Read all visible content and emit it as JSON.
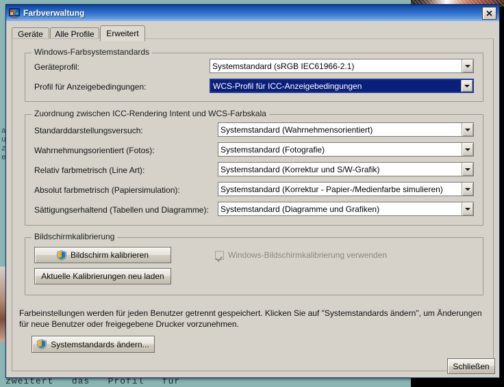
{
  "window": {
    "title": "Farbverwaltung",
    "icon": "color-monitor-icon",
    "close_label": "✕"
  },
  "tabs": [
    {
      "label": "Geräte",
      "active": false
    },
    {
      "label": "Alle Profile",
      "active": false
    },
    {
      "label": "Erweitert",
      "active": true
    }
  ],
  "groups": {
    "system_defaults": {
      "legend": "Windows-Farbsystemstandards",
      "rows": [
        {
          "label": "Geräteprofil:",
          "value": "Systemstandard (sRGB IEC61966-2.1)",
          "focused": false
        },
        {
          "label": "Profil für Anzeigebedingungen:",
          "value": "WCS-Profil für ICC-Anzeigebedingungen",
          "focused": true
        }
      ]
    },
    "rendering_intent": {
      "legend": "Zuordnung zwischen ICC-Rendering Intent und WCS-Farbskala",
      "rows": [
        {
          "label": "Standarddarstellungsversuch:",
          "value": "Systemstandard (Wahrnehmensorientiert)",
          "focused": false
        },
        {
          "label": "Wahrnehmungsorientiert (Fotos):",
          "value": "Systemstandard (Fotografie)",
          "focused": false
        },
        {
          "label": "Relativ farbmetrisch (Line Art):",
          "value": "Systemstandard (Korrektur und S/W-Grafik)",
          "focused": false
        },
        {
          "label": "Absolut farbmetrisch (Papiersimulation):",
          "value": "Systemstandard (Korrektur - Papier-/Medienfarbe simulieren)",
          "focused": false
        },
        {
          "label": "Sättigungserhaltend (Tabellen und Diagramme):",
          "value": "Systemstandard (Diagramme und Grafiken)",
          "focused": false
        }
      ]
    },
    "calibration": {
      "legend": "Bildschirmkalibrierung",
      "calibrate_button": "Bildschirm kalibrieren",
      "reload_button": "Aktuelle Kalibrierungen neu laden",
      "checkbox_label": "Windows-Bildschirmkalibrierung verwenden",
      "checkbox_checked": true,
      "checkbox_disabled": true
    }
  },
  "footer": {
    "info_line1": "Farbeinstellungen werden für jeden Benutzer getrennt gespeichert. Klicken Sie auf \"Systemstandards ändern\", um Änderungen",
    "info_line2": "für neue Benutzer oder freigegebene Drucker vorzunehmen.",
    "change_defaults_button": "Systemstandards ändern...",
    "close_button": "Schließen"
  },
  "background": {
    "bottom_text": "zweitert   das   Profil   für",
    "left_text": "a\nu\nz\ne"
  },
  "colors": {
    "desktop": "#8ab5b3",
    "dialog_face": "#d6d2ca",
    "titlebar_start": "#0b3c91",
    "titlebar_end": "#96bdec",
    "selection": "#0a1f7a",
    "field_border": "#7b7a72",
    "focus_border": "#1b3a8f",
    "disabled_text": "#8b8880"
  }
}
